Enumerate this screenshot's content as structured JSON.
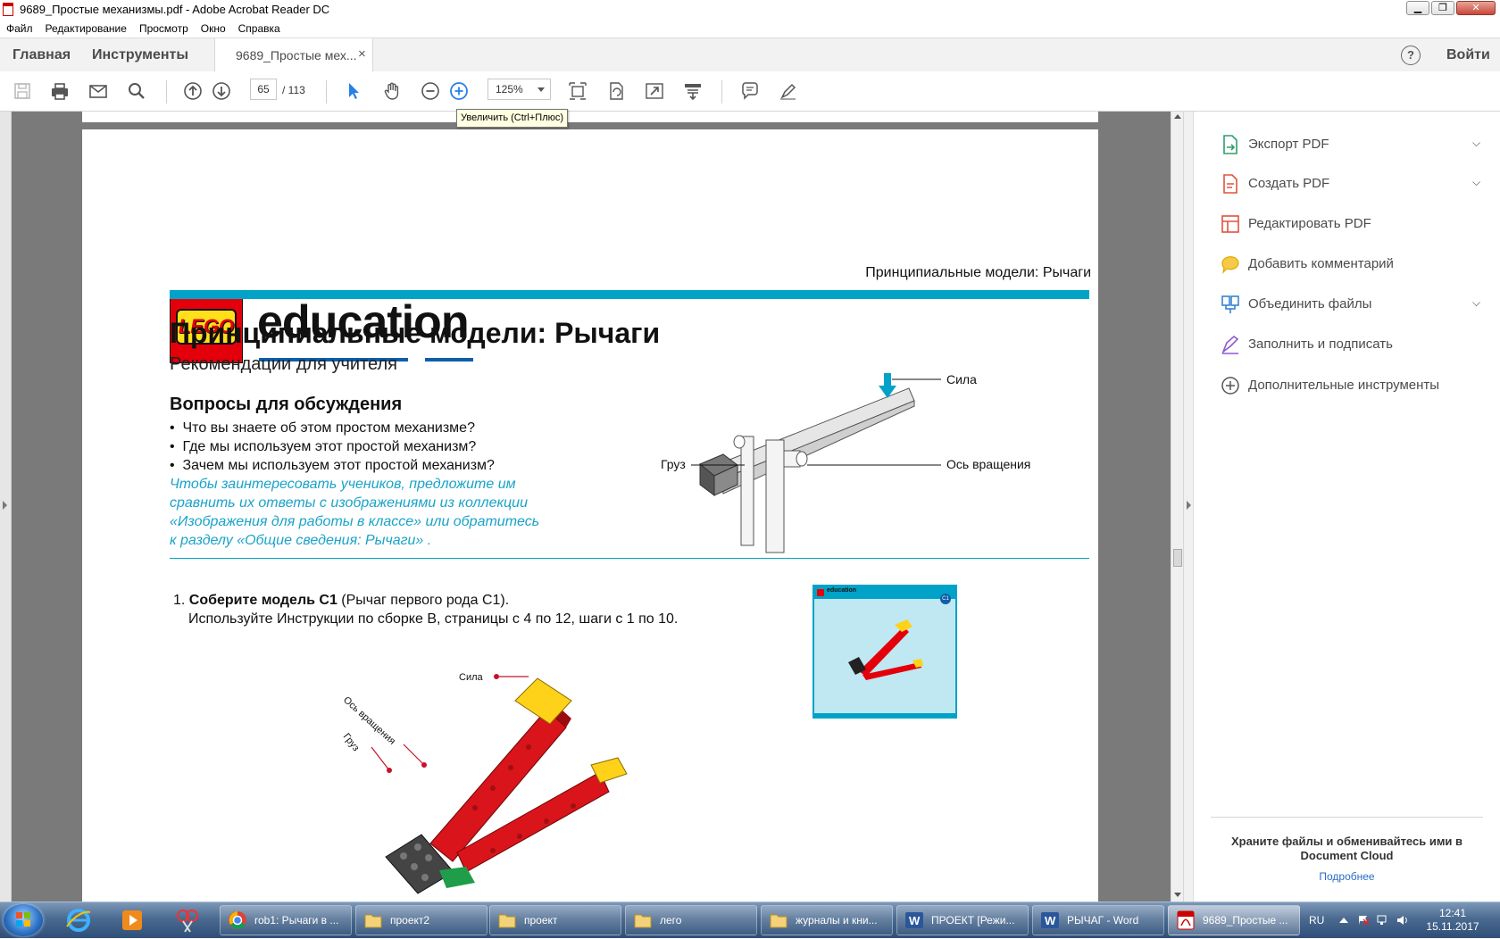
{
  "window": {
    "title": "9689_Простые механизмы.pdf - Adobe Acrobat Reader DC",
    "minimize": "▁",
    "restore": "❐",
    "close": "✕"
  },
  "menu": [
    "Файл",
    "Редактирование",
    "Просмотр",
    "Окно",
    "Справка"
  ],
  "tabs": {
    "home": "Главная",
    "tools": "Инструменты",
    "document": "9689_Простые мех...",
    "close": "×",
    "help": "?",
    "signin": "Войти"
  },
  "toolbar": {
    "page_current": "65",
    "page_total": "/  113",
    "zoom": "125%",
    "tooltip": "Увеличить (Ctrl+Плюс)"
  },
  "document": {
    "brand_word": "education",
    "logo_text": "LEGO",
    "header_right": "Принципиальные модели: Рычаги",
    "title": "Принципиальные модели: Рычаги",
    "subtitle": "Рекомендации для учителя",
    "questions_heading": "Вопросы для обсуждения",
    "questions": [
      "Что вы знаете об этом простом механизме?",
      "Где мы используем этот простой механизм?",
      "Зачем мы используем этот простой механизм?"
    ],
    "bullet": "•",
    "teacher_note": [
      "Чтобы заинтересовать учеников, предложите им",
      "сравнить их ответы с изображениями из коллекции",
      "«Изображения для работы в классе» или обратитесь",
      "к разделу «Общие сведения: Рычаги» ."
    ],
    "diagram_labels": {
      "force": "Сила",
      "load": "Груз",
      "pivot": "Ось вращения"
    },
    "step1_number": "1.",
    "step1_bold": "Соберите модель C1",
    "step1_rest": " (Рычаг первого рода C1).",
    "step1_line2": "Используйте Инструкции по сборке B, страницы с 4 по 12, шаги с 1 по 10.",
    "thumbnail_badge": "C1",
    "thumbnail_brand": "education",
    "model_labels": {
      "force": "Сила",
      "pivot": "Ось вращения",
      "load": "Груз"
    }
  },
  "right_panel": {
    "tools": [
      {
        "label": "Экспорт PDF",
        "icon": "export-pdf-icon",
        "has_menu": true,
        "color": "#2d9f6f"
      },
      {
        "label": "Создать PDF",
        "icon": "create-pdf-icon",
        "has_menu": true,
        "color": "#e0533e"
      },
      {
        "label": "Редактировать PDF",
        "icon": "edit-pdf-icon",
        "has_menu": false,
        "color": "#e0533e"
      },
      {
        "label": "Добавить комментарий",
        "icon": "comment-icon",
        "has_menu": false,
        "color": "#f0b400"
      },
      {
        "label": "Объединить файлы",
        "icon": "combine-files-icon",
        "has_menu": true,
        "color": "#2b7bd0"
      },
      {
        "label": "Заполнить и подписать",
        "icon": "fill-sign-icon",
        "has_menu": false,
        "color": "#8b5ad0"
      },
      {
        "label": "Дополнительные инструменты",
        "icon": "more-tools-icon",
        "has_menu": false,
        "color": "#555555"
      }
    ],
    "chevron": "⌄",
    "cloud_text": "Храните файлы и обменивайтесь ими в Document Cloud",
    "cloud_link": "Подробнее"
  },
  "taskbar": {
    "tasks": [
      {
        "label": "rob1: Рычаги в ...",
        "icon": "chrome-icon"
      },
      {
        "label": "проект2",
        "icon": "folder-icon"
      },
      {
        "label": "проект",
        "icon": "folder-icon"
      },
      {
        "label": "лего",
        "icon": "folder-icon"
      },
      {
        "label": "журналы и кни...",
        "icon": "folder-icon"
      },
      {
        "label": "ПРОЕКТ [Режи...",
        "icon": "word-icon"
      },
      {
        "label": "РЫЧАГ - Word",
        "icon": "word-icon"
      },
      {
        "label": "9689_Простые ...",
        "icon": "acrobat-icon"
      }
    ],
    "lang": "RU",
    "time": "12:41",
    "date": "15.11.2017"
  },
  "colors": {
    "cyan": "#00a3c7",
    "lego_red": "#e3000b",
    "lego_yellow": "#ffe01a",
    "edu_blue": "#0e5ea8",
    "acrobat_blue": "#2680eb"
  }
}
